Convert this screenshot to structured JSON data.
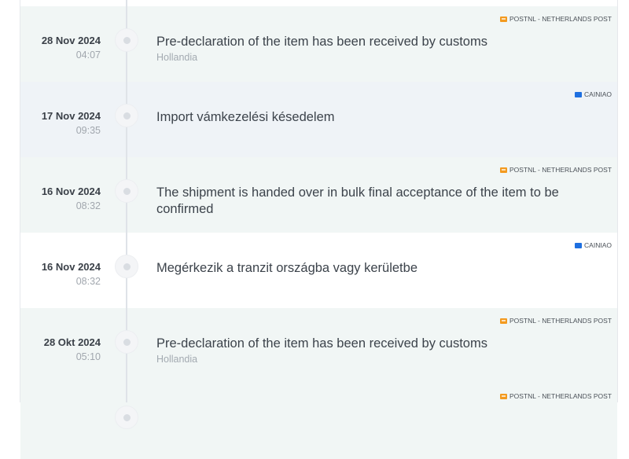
{
  "events": [
    {
      "date": "28 Nov 2024",
      "time": "04:07",
      "description": "Pre-declaration of the item has been received by customs",
      "location": "Hollandia",
      "carrier": "POSTNL - NETHERLANDS POST",
      "carrier_icon": "postnl-logo-icon"
    },
    {
      "date": "17 Nov 2024",
      "time": "09:35",
      "description": "Import vámkezelési késedelem",
      "location": "",
      "carrier": "CAINIAO",
      "carrier_icon": "cainiao-logo-icon"
    },
    {
      "date": "16 Nov 2024",
      "time": "08:32",
      "description": "The shipment is handed over in bulk final acceptance of the item to be confirmed",
      "location": "",
      "carrier": "POSTNL - NETHERLANDS POST",
      "carrier_icon": "postnl-logo-icon"
    },
    {
      "date": "16 Nov 2024",
      "time": "08:32",
      "description": "Megérkezik a tranzit országba vagy kerületbe",
      "location": "",
      "carrier": "CAINIAO",
      "carrier_icon": "cainiao-logo-icon"
    },
    {
      "date": "28 Okt 2024",
      "time": "05:10",
      "description": "Pre-declaration of the item has been received by customs",
      "location": "Hollandia",
      "carrier": "POSTNL - NETHERLANDS POST",
      "carrier_icon": "postnl-logo-icon"
    },
    {
      "date": "",
      "time": "",
      "description": "",
      "location": "",
      "carrier": "POSTNL - NETHERLANDS POST",
      "carrier_icon": "postnl-logo-icon"
    }
  ],
  "colors": {
    "postnl_orange": "#f39a1f",
    "cainiao_blue": "#1e6fe0",
    "row_green": "#f1f6f5",
    "row_blue": "#eff3f7"
  }
}
